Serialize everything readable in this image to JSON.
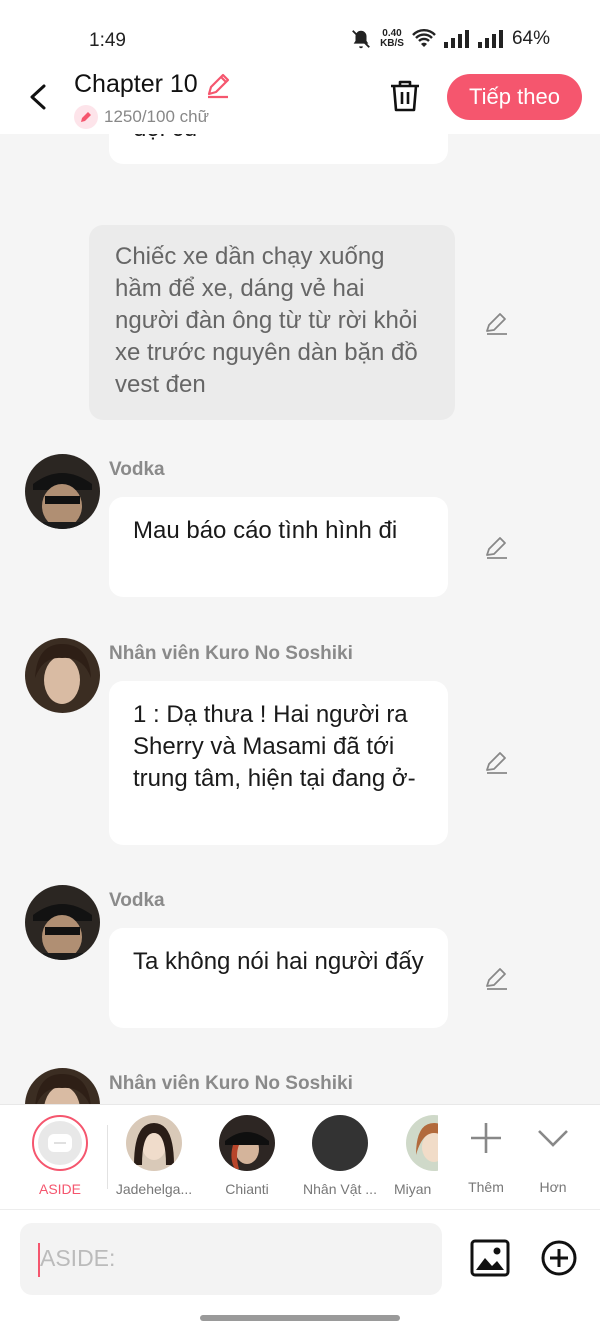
{
  "status": {
    "time": "1:49",
    "speed_value": "0.40",
    "speed_unit": "KB/S",
    "battery": "64%"
  },
  "header": {
    "title": "Chapter 10",
    "word_count": "1250/100 chữ",
    "next_label": "Tiếp theo"
  },
  "messages": {
    "partial": "đội cũ",
    "narration": "Chiếc xe dần chạy xuống hầm để xe, dáng vẻ hai người đàn ông từ từ rời khỏi xe trước nguyên dàn bặn đồ vest đen",
    "m1": {
      "name": "Vodka",
      "text": "Mau báo cáo tình hình đi"
    },
    "m2": {
      "name": "Nhân viên Kuro No Soshiki",
      "text": "1 : Dạ thưa ! Hai người ra Sherry và Masami đã tới trung tâm, hiện tại đang ở-"
    },
    "m3": {
      "name": "Vodka",
      "text": "Ta không nói hai người đấy"
    },
    "m4": {
      "name": "Nhân viên Kuro No Soshiki"
    }
  },
  "characters": {
    "aside": "ASIDE",
    "c1": "Jadehelga...",
    "c2": "Chianti",
    "c3": "Nhân Vật ...",
    "c4": "Miyan",
    "more": "Thêm",
    "less": "Hơn"
  },
  "input": {
    "placeholder": "ASIDE:"
  },
  "colors": {
    "accent": "#f5566e",
    "background": "#f5f5f5",
    "bubble": "#ffffff",
    "narration": "#ebebeb"
  }
}
